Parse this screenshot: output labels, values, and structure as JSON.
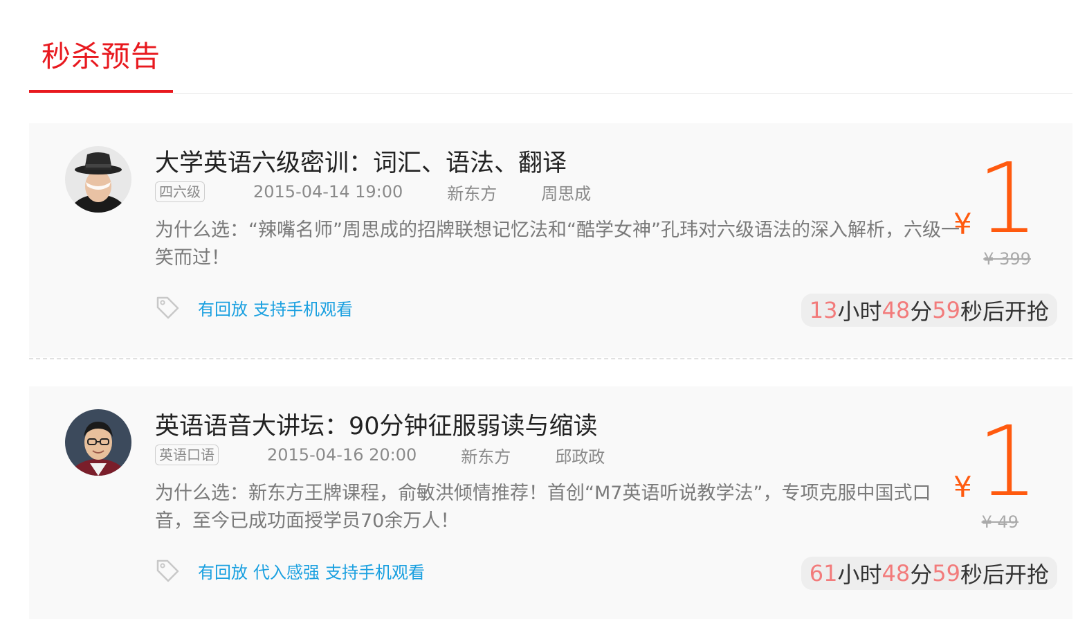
{
  "tab": {
    "title": "秒杀预告"
  },
  "courses": [
    {
      "title": "大学英语六级密训：词汇、语法、翻译",
      "category": "四六级",
      "datetime": "2015-04-14 19:00",
      "organization": "新东方",
      "teacher": "周思成",
      "description": "为什么选：“辣嘴名师”周思成的招牌联想记忆法和“酷学女神”孔玮对六级语法的深入解析，六级一笑而过！",
      "features": [
        "有回放",
        "支持手机观看"
      ],
      "currency": "¥",
      "price": "1",
      "original_price": "¥ 399",
      "countdown": {
        "hours": "13",
        "hours_unit": "小时",
        "minutes": "48",
        "minutes_unit": "分",
        "seconds": "59",
        "seconds_unit": "秒后开抢"
      },
      "avatar_icon": "teacher-avatar-hat"
    },
    {
      "title": "英语语音大讲坛：90分钟征服弱读与缩读",
      "category": "英语口语",
      "datetime": "2015-04-16 20:00",
      "organization": "新东方",
      "teacher": "邱政政",
      "description": "为什么选：新东方王牌课程，俞敏洪倾情推荐！首创“M7英语听说教学法”，专项克服中国式口音，至今已成功面授学员70余万人！",
      "features": [
        "有回放",
        "代入感强",
        "支持手机观看"
      ],
      "currency": "¥",
      "price": "1",
      "original_price": "¥ 49",
      "countdown": {
        "hours": "61",
        "hours_unit": "小时",
        "minutes": "48",
        "minutes_unit": "分",
        "seconds": "59",
        "seconds_unit": "秒后开抢"
      },
      "avatar_icon": "teacher-avatar-glasses"
    }
  ],
  "colors": {
    "accent": "#e8191f",
    "price": "#ff5a0f",
    "feature": "#1aa0e0",
    "countdown_num": "#f27b7b"
  }
}
